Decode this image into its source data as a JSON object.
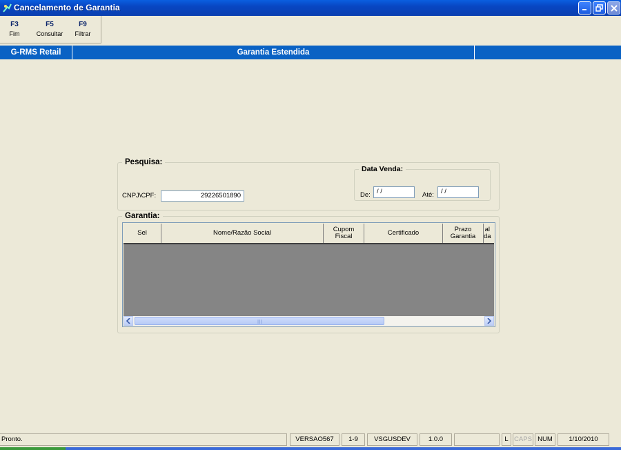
{
  "window": {
    "title": "Cancelamento de Garantia"
  },
  "toolbar": {
    "buttons": [
      {
        "key": "F3",
        "label": "Fim"
      },
      {
        "key": "F5",
        "label": "Consultar"
      },
      {
        "key": "F9",
        "label": "Filtrar"
      }
    ]
  },
  "header": {
    "app_name": "G-RMS Retail",
    "page_title": "Garantia Estendida"
  },
  "pesquisa": {
    "legend": "Pesquisa:",
    "cpf_label": "CNPJ\\CPF:",
    "cpf_value": "29226501890",
    "data_venda": {
      "legend": "Data Venda:",
      "de_label": "De:",
      "de_value": "/ /",
      "ate_label": "Até:",
      "ate_value": "/ /"
    }
  },
  "garantia": {
    "legend": "Garantia:",
    "columns": [
      "Sel",
      "Nome/Razão Social",
      "Cupom\nFiscal",
      "Certificado",
      "Prazo\nGarantia",
      "al\nda"
    ],
    "rows": []
  },
  "status": {
    "message": "Pronto.",
    "version": "VERSAO567",
    "range": "1-9",
    "server": "VSGUSDEV",
    "build": "1.0.0",
    "blank": "",
    "l_indicator": "L",
    "caps": "CAPS",
    "num": "NUM",
    "date": "1/10/2010"
  },
  "colors": {
    "title_bar": "#0a4fd0",
    "header_bar": "#0a62c4",
    "grid_empty": "#858585",
    "window_bg": "#ece9d8"
  },
  "icons": {
    "app": "app-icon",
    "minimize": "minimize-icon",
    "restore": "restore-icon",
    "close": "close-icon",
    "scroll_left": "arrow-left-icon",
    "scroll_right": "arrow-right-icon"
  }
}
